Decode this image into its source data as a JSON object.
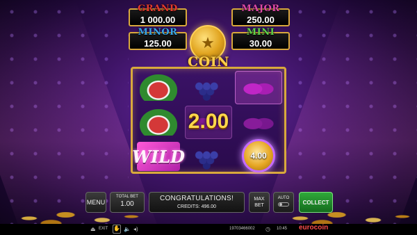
{
  "jackpots": {
    "grand": {
      "title": "GRAND",
      "value": "1 000.00"
    },
    "major": {
      "title": "MAJOR",
      "value": "250.00"
    },
    "minor": {
      "title": "MINOR",
      "value": "125.00"
    },
    "mini": {
      "title": "MINI",
      "value": "30.00"
    }
  },
  "logo": "COIN FRENZY",
  "reels": {
    "win_amount": "2.00",
    "coin_value": "4.00",
    "wild_label": "WILD",
    "grid": [
      [
        "watermelon",
        "grapes",
        "plum"
      ],
      [
        "watermelon",
        "plum",
        "plum"
      ],
      [
        "wild",
        "grapes",
        "coin"
      ]
    ]
  },
  "controls": {
    "menu_label": "MENU",
    "total_bet_label": "TOTAL BET",
    "total_bet_value": "1.00",
    "message": "CONGRATULATIONS!",
    "credits": "CREDITS: 496.00",
    "max_bet_label": "MAX BET",
    "auto_label": "AUTO",
    "collect_label": "COLLECT"
  },
  "status_bar": {
    "exit_label": "EXIT",
    "ticket_id": "19703466002",
    "time": "10:45",
    "brand_part1": "eurocoin",
    "brand_part2": ""
  },
  "colors": {
    "grand": "#e53a2e",
    "major": "#e04aa8",
    "minor": "#3aa6e8",
    "mini": "#5fd34a",
    "gold": "#d9a93c",
    "collect": "#2fa93a"
  }
}
